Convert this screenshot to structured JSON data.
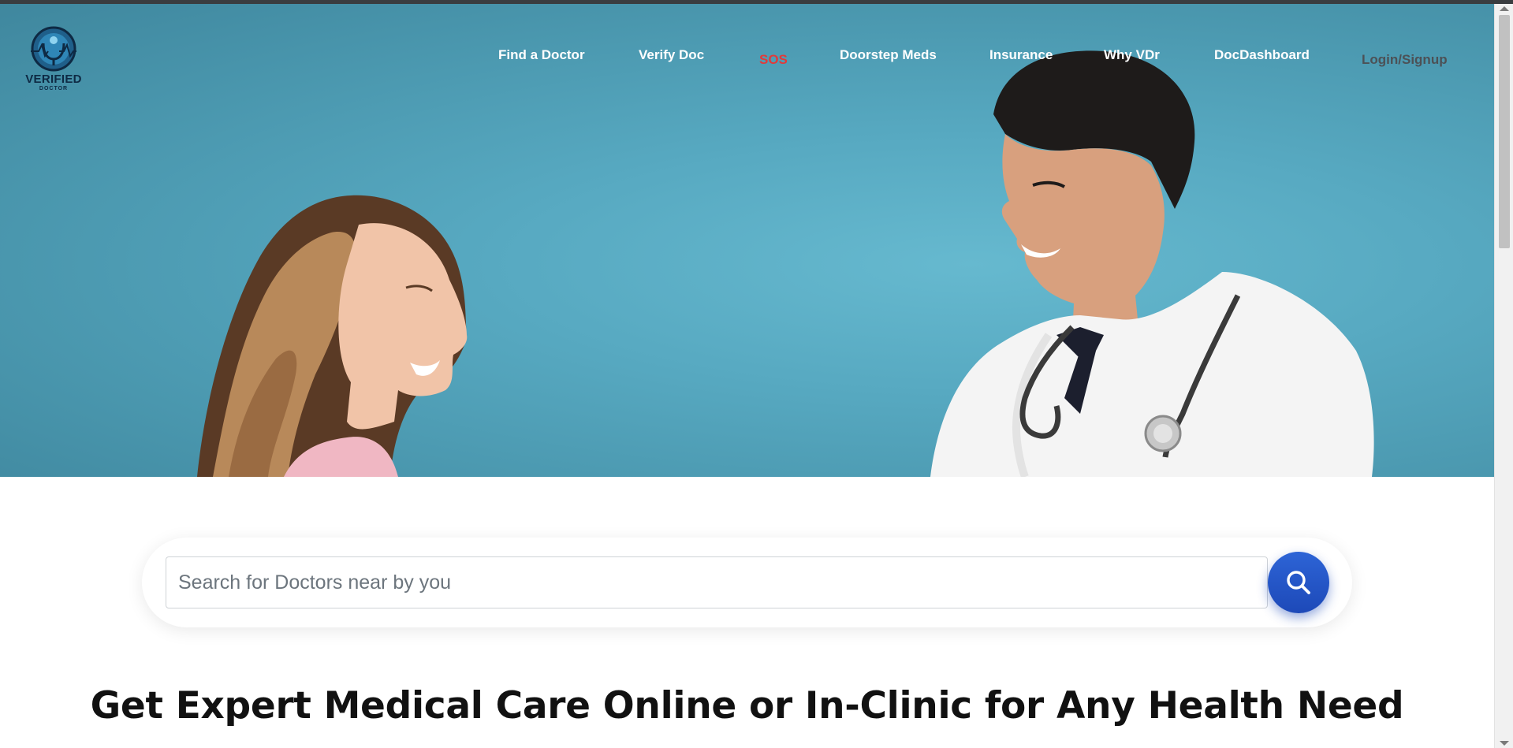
{
  "brand": {
    "logo_text": "VERIFIED",
    "logo_subtext": "DOCTOR"
  },
  "nav": {
    "items": [
      {
        "label": "Find a Doctor"
      },
      {
        "label": "Verify Doc"
      },
      {
        "label": "SOS"
      },
      {
        "label": "Doorstep Meds"
      },
      {
        "label": "Insurance"
      },
      {
        "label": "Why VDr"
      },
      {
        "label": "DocDashboard"
      }
    ],
    "login_label": "Login/Signup"
  },
  "search": {
    "placeholder": "Search for Doctors near by you",
    "value": "",
    "button_icon": "search-icon"
  },
  "main": {
    "headline": "Get Expert Medical Care Online or In-Clinic for Any Health Need"
  },
  "colors": {
    "hero_background": "#57a9c1",
    "sos": "#e23a3a",
    "search_button": "#1d49b8"
  }
}
